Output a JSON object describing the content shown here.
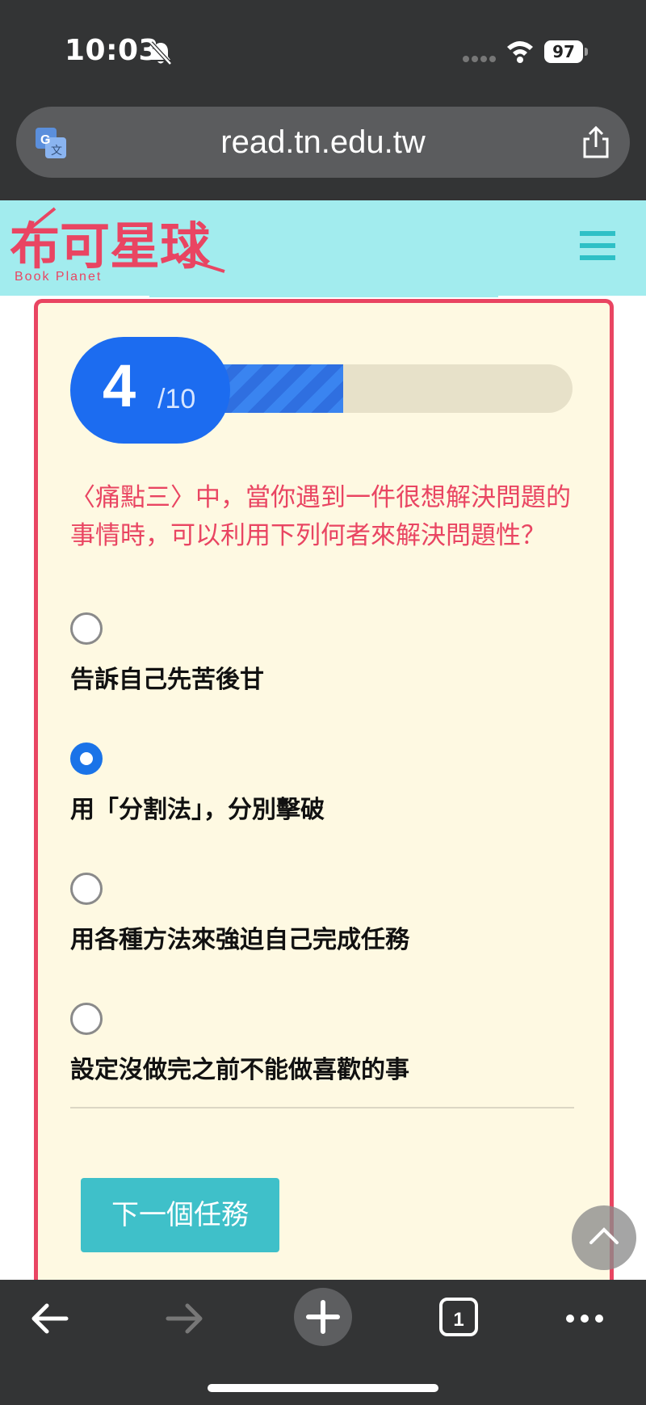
{
  "status_bar": {
    "time": "10:03",
    "battery": "97",
    "icons": [
      "bell-slash-icon",
      "signal-icon",
      "wifi-icon",
      "battery-icon"
    ]
  },
  "url_bar": {
    "url": "read.tn.edu.tw",
    "icons": [
      "translate-icon",
      "share-icon"
    ]
  },
  "site": {
    "logo_text": "布可星球",
    "logo_subtext": "Book Planet",
    "menu_icon": "hamburger-menu-icon"
  },
  "quiz": {
    "progress": {
      "current": "4",
      "total": "/10",
      "fraction": 0.4
    },
    "question": "〈痛點三〉中，當你遇到一件很想解決問題的事情時，可以利用下列何者來解決問題性？",
    "options": [
      {
        "label": "告訴自己先苦後甘",
        "selected": false
      },
      {
        "label": "用「分割法」，分別擊破",
        "selected": true
      },
      {
        "label": "用各種方法來強迫自己完成任務",
        "selected": false
      },
      {
        "label": "設定沒做完之前不能做喜歡的事",
        "selected": false
      }
    ],
    "next_button": "下一個任務"
  },
  "toolbar": {
    "icons": [
      "back-arrow-icon",
      "forward-arrow-icon",
      "new-tab-plus-icon",
      "tabs-count-icon",
      "more-dots-icon"
    ],
    "tab_count": "1"
  },
  "colors": {
    "accent": "#e94562",
    "progress_blue": "#1c6cf0",
    "header_cyan": "#a2ecee",
    "card_bg": "#fef9e2",
    "button_teal": "#3fc0c9"
  }
}
